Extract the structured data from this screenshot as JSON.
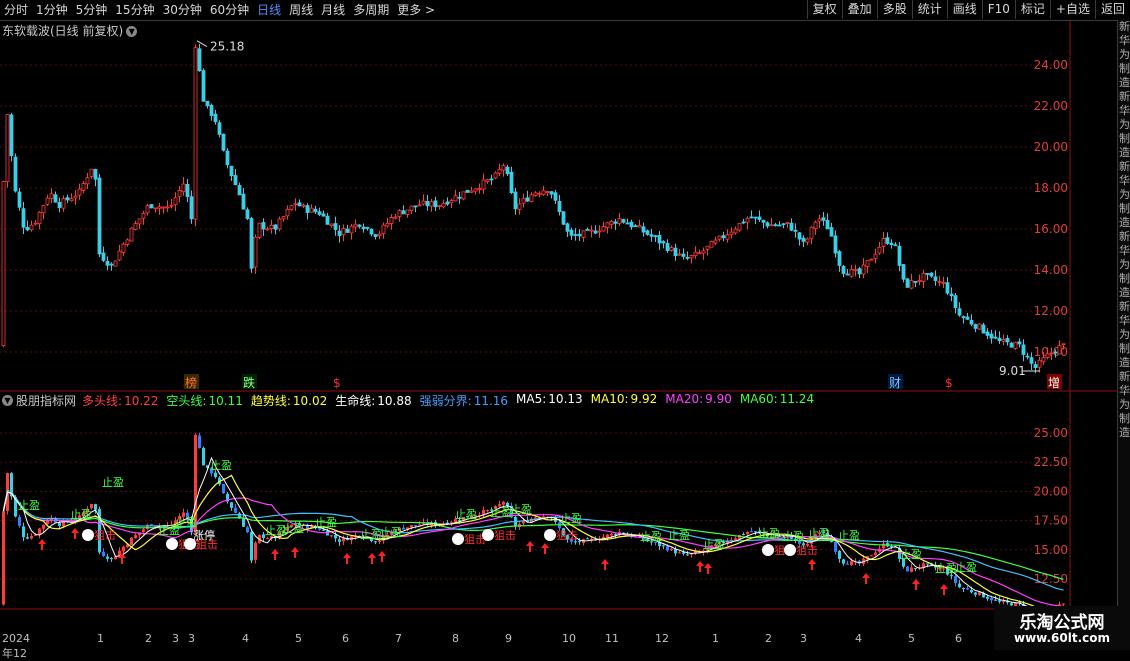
{
  "toolbar": {
    "periods": [
      "分时",
      "1分钟",
      "5分钟",
      "15分钟",
      "30分钟",
      "60分钟",
      "日线",
      "周线",
      "月线",
      "多周期",
      "更多 >"
    ],
    "active_period": "日线",
    "buttons": [
      "复权",
      "叠加",
      "多股",
      "统计",
      "画线",
      "F10",
      "标记",
      "+自选",
      "返回"
    ]
  },
  "price_panel": {
    "title": "东软载波(日线 前复权)",
    "high_label": "25.18",
    "low_label": "9.01",
    "y_ticks": [
      "24.00",
      "22.00",
      "20.00",
      "18.00",
      "16.00",
      "14.00",
      "12.00",
      "10.00"
    ],
    "event_markers": [
      "榜",
      "跌",
      "$",
      "财",
      "$",
      "增"
    ]
  },
  "indicator_panel": {
    "name": "股朋指标网",
    "values": [
      {
        "label": "多头线:",
        "value": "10.22",
        "color": "#ff4040"
      },
      {
        "label": "空头线:",
        "value": "10.11",
        "color": "#40ff40"
      },
      {
        "label": "趋势线:",
        "value": "10.02",
        "color": "#ffff40"
      },
      {
        "label": "生命线:",
        "value": "10.88",
        "color": "#ffffff"
      },
      {
        "label": "强弱分界:",
        "value": "11.16",
        "color": "#40a0ff"
      },
      {
        "label": "MA5:",
        "value": "10.13",
        "color": "#ffffff"
      },
      {
        "label": "MA10:",
        "value": "9.92",
        "color": "#ffff40"
      },
      {
        "label": "MA20:",
        "value": "9.90",
        "color": "#ff40ff"
      },
      {
        "label": "MA60:",
        "value": "11.24",
        "color": "#40ff40"
      }
    ],
    "y_ticks": [
      "25.00",
      "22.50",
      "20.00",
      "17.50",
      "15.00",
      "12.50"
    ],
    "signal_labels": [
      "止盈",
      "狙击",
      "涨停"
    ]
  },
  "date_axis": [
    "2024年12",
    "1",
    "2",
    "3",
    "3",
    "4",
    "5",
    "6",
    "7",
    "8",
    "9",
    "10",
    "11",
    "12",
    "1",
    "2",
    "3",
    "4",
    "5",
    "6"
  ],
  "side_chars": [
    "新",
    "华",
    "为",
    "制",
    "造"
  ],
  "watermark": {
    "line1": "乐淘公式网",
    "line2": "www.60lt.com"
  }
}
